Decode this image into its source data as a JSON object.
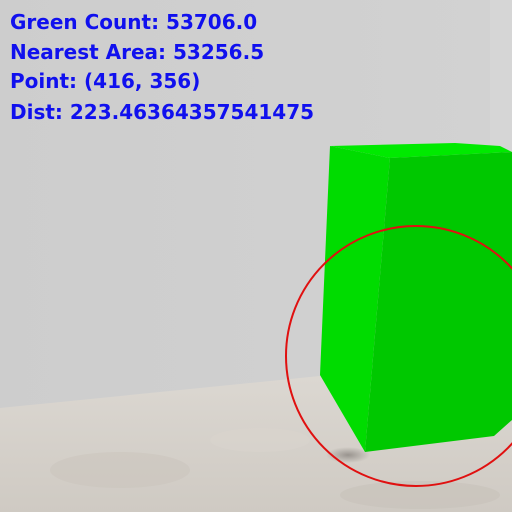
{
  "overlay": {
    "green_count": "Green Count: 53706.0",
    "nearest_area": "Nearest Area: 53256.5",
    "point": "Point: (416, 356)",
    "dist": "Dist: 223.46364357541475"
  },
  "colors": {
    "wall": "#cfcfcf",
    "floor": "#d6d2cd",
    "box_front": "#00c800",
    "box_left": "#00dc00",
    "box_top": "#00ea00",
    "circle": "#e01010",
    "text": "#1010ee"
  }
}
